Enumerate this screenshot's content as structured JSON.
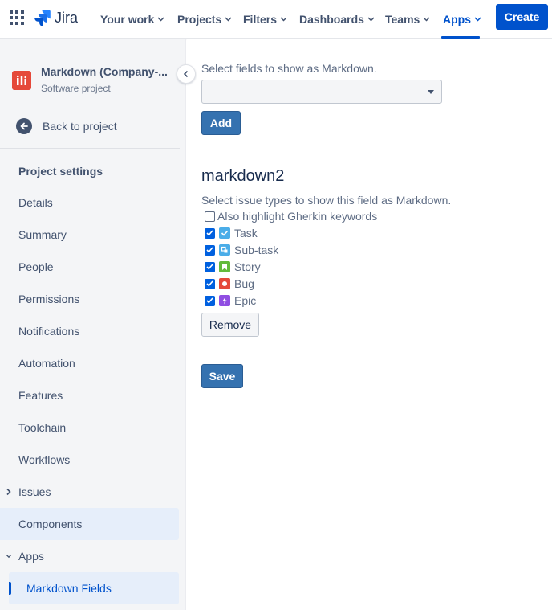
{
  "topnav": {
    "app_switcher_icon": "grid-icon",
    "logo_text": "Jira",
    "items": [
      {
        "label": "Your work"
      },
      {
        "label": "Projects"
      },
      {
        "label": "Filters"
      },
      {
        "label": "Dashboards"
      },
      {
        "label": "Teams"
      },
      {
        "label": "Apps"
      }
    ],
    "active_item": "Apps",
    "create_label": "Create",
    "colors": {
      "accent": "#0052cc"
    }
  },
  "sidebar": {
    "project_name": "Markdown (Company-...",
    "project_type": "Software project",
    "back_label": "Back to project",
    "section_title": "Project settings",
    "items": [
      {
        "label": "Details"
      },
      {
        "label": "Summary"
      },
      {
        "label": "People"
      },
      {
        "label": "Permissions"
      },
      {
        "label": "Notifications"
      },
      {
        "label": "Automation"
      },
      {
        "label": "Features"
      },
      {
        "label": "Toolchain"
      },
      {
        "label": "Workflows"
      },
      {
        "label": "Issues"
      },
      {
        "label": "Components"
      },
      {
        "label": "Apps"
      },
      {
        "label": "Markdown Fields"
      }
    ],
    "selected_item": "Markdown Fields"
  },
  "main": {
    "select_label": "Select fields to show as Markdown.",
    "select_value": "",
    "add_label": "Add",
    "field_title": "markdown2",
    "issue_types_label": "Select issue types to show this field as Markdown.",
    "gherkin_label": "Also highlight Gherkin keywords",
    "gherkin_checked": false,
    "issue_types": [
      {
        "label": "Task",
        "checked": true,
        "icon": "task-icon",
        "color": "#4bade8"
      },
      {
        "label": "Sub-task",
        "checked": true,
        "icon": "subtask-icon",
        "color": "#4bade8"
      },
      {
        "label": "Story",
        "checked": true,
        "icon": "story-icon",
        "color": "#63ba3c"
      },
      {
        "label": "Bug",
        "checked": true,
        "icon": "bug-icon",
        "color": "#e5493a"
      },
      {
        "label": "Epic",
        "checked": true,
        "icon": "epic-icon",
        "color": "#904ee2"
      }
    ],
    "remove_label": "Remove",
    "save_label": "Save"
  }
}
